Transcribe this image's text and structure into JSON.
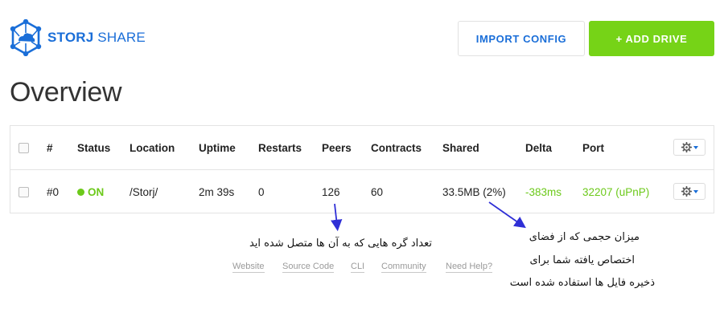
{
  "app": {
    "brand_bold": "STORJ",
    "brand_light": " SHARE"
  },
  "toolbar": {
    "import_label": "IMPORT CONFIG",
    "add_label": "+ ADD DRIVE"
  },
  "page": {
    "title": "Overview"
  },
  "table": {
    "headers": [
      "#",
      "Status",
      "Location",
      "Uptime",
      "Restarts",
      "Peers",
      "Contracts",
      "Shared",
      "Delta",
      "Port"
    ],
    "rows": [
      {
        "id": "#0",
        "status": "ON",
        "location": "/Storj/",
        "uptime": "2m 39s",
        "restarts": "0",
        "peers": "126",
        "contracts": "60",
        "shared": "33.5MB (2%)",
        "delta": "-383ms",
        "port": "32207 (uPnP)"
      }
    ]
  },
  "annotations": {
    "peers_note": "تعداد گره هایی که به آن ها متصل شده اید",
    "shared_note_line1": "میزان حجمی که از فضای",
    "shared_note_line2": "اختصاص یافته شما برای",
    "shared_note_line3": "ذخیره فایل ها استفاده شده است"
  },
  "footer": {
    "links": [
      "Website",
      "Source Code",
      "CLI",
      "Community",
      "Need Help?"
    ]
  },
  "colors": {
    "brand_blue": "#1a6ed8",
    "accent_green": "#76d317",
    "status_green": "#6cc91a",
    "annotation_arrow": "#2f2fd6"
  }
}
